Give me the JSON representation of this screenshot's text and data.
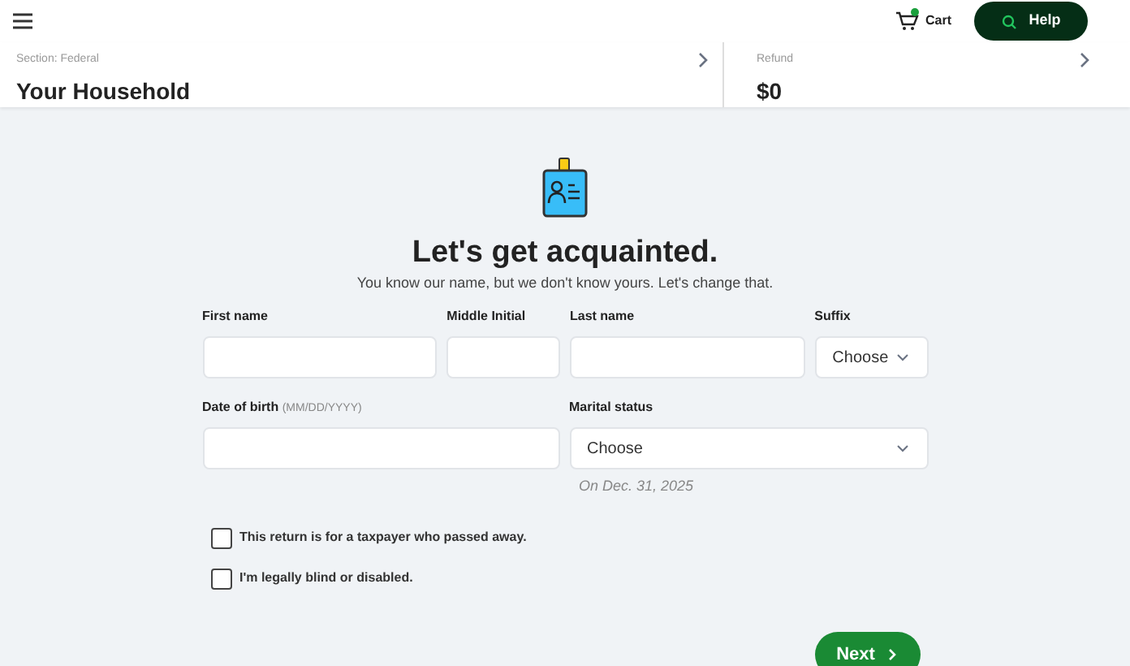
{
  "header": {
    "cart_label": "Cart",
    "help_label": "Help"
  },
  "section_bar": {
    "section_caption": "Section: Federal",
    "section_title": "Your Household",
    "refund_caption": "Refund",
    "refund_amount": "$0"
  },
  "intro": {
    "title": "Let's get acquainted.",
    "subtitle": "You know our name, but we don't know yours. Let's change that."
  },
  "name_fields": [
    {
      "label": "First name",
      "kind": "input"
    },
    {
      "label": "Middle Initial",
      "kind": "input"
    },
    {
      "label": "Last name",
      "kind": "input"
    },
    {
      "label": "Suffix",
      "kind": "select",
      "value": "Choose"
    }
  ],
  "birth_field": {
    "label": "Date of birth",
    "hint": "(MM/DD/YYYY)"
  },
  "marital_field": {
    "label": "Marital status",
    "value": "Choose",
    "note": "On Dec. 31, 2025"
  },
  "checkboxes": [
    {
      "label": "This return is for a taxpayer who passed away.",
      "checked": false
    },
    {
      "label": "I'm legally blind or disabled.",
      "checked": false
    }
  ],
  "next_button": {
    "label": "Next"
  }
}
